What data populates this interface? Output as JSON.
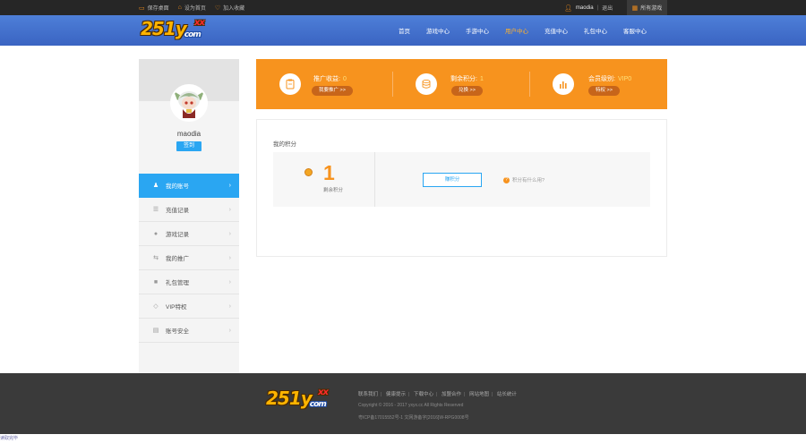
{
  "topbar": {
    "items": [
      "保存桌面",
      "设为首页",
      "加入收藏"
    ],
    "username": "maodia",
    "logout": "退出",
    "all_games": "所有游戏"
  },
  "logo": {
    "main": "251y",
    "xx": "xx",
    "sub": "com"
  },
  "nav": [
    "首页",
    "游戏中心",
    "手游中心",
    "用户中心",
    "充值中心",
    "礼包中心",
    "客服中心"
  ],
  "nav_active_index": 3,
  "sidebar": {
    "username": "maodia",
    "sign_label": "签到",
    "menu": [
      {
        "label": "我的账号",
        "icon": "user-icon",
        "active": true
      },
      {
        "label": "充值记录",
        "icon": "list-icon",
        "active": false
      },
      {
        "label": "游戏记录",
        "icon": "info-icon",
        "active": false
      },
      {
        "label": "我的推广",
        "icon": "share-icon",
        "active": false
      },
      {
        "label": "礼包管理",
        "icon": "lock-icon",
        "active": false
      },
      {
        "label": "VIP特权",
        "icon": "diamond-icon",
        "active": false
      },
      {
        "label": "账号安全",
        "icon": "shield-icon",
        "active": false
      }
    ]
  },
  "stats": {
    "promo": {
      "label": "推广收益:",
      "value": "0",
      "button": "我要推广 >>"
    },
    "points": {
      "label": "剩余积分:",
      "value": "1",
      "button": "兑换 >>"
    },
    "vip": {
      "label": "会员级别:",
      "value": "VIP0",
      "button": "特权 >>"
    }
  },
  "points_panel": {
    "title": "我的积分",
    "value": "1",
    "caption": "剩余积分",
    "earn_button": "赚积分",
    "help_text": "积分有什么用?"
  },
  "footer": {
    "logo_main": "251y",
    "logo_xx": "xx",
    "logo_sub": "com",
    "links": [
      "联系我们",
      "健康提示",
      "下载中心",
      "加盟合作",
      "网站地图",
      "站长统计"
    ],
    "copyright": "Copyright © 2016 - 2017 yxyx.cc All Rights Reserved",
    "icp": "粤ICP备17015552号-1 文网游备字[2016]W-RPG0008号"
  },
  "status_text": "读取完毕"
}
